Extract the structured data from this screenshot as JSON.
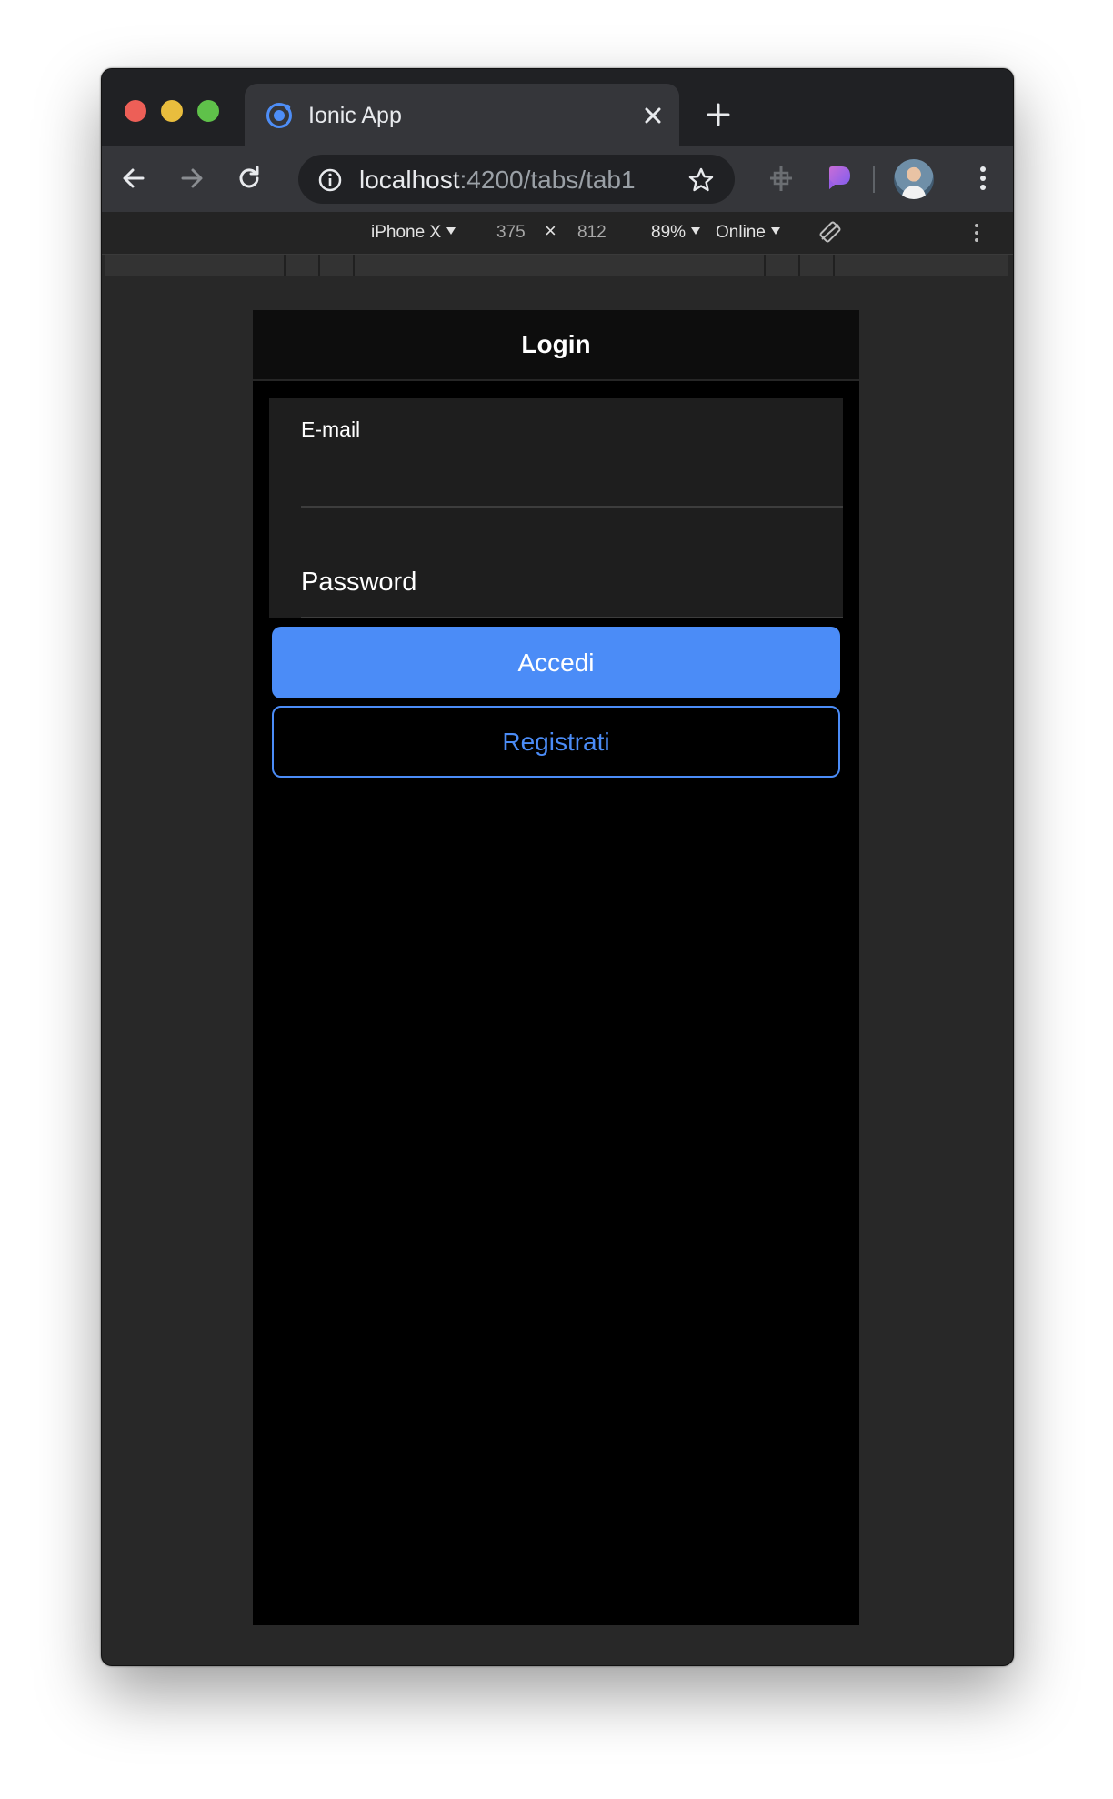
{
  "browser": {
    "tab": {
      "title": "Ionic App",
      "icon": "ionic-logo-icon",
      "close_icon": "close-icon"
    },
    "new_tab_icon": "plus-icon",
    "toolbar": {
      "back_icon": "back-arrow-icon",
      "forward_icon": "forward-arrow-icon",
      "reload_icon": "reload-icon",
      "url_host": "localhost",
      "url_path": ":4200/tabs/tab1",
      "info_icon": "info-icon",
      "bookmark_icon": "star-icon",
      "extension_icons": [
        "crosshair-extension-icon",
        "purple-extension-icon"
      ],
      "menu_icon": "kebab-menu-icon",
      "profile_icon": "profile-avatar"
    }
  },
  "devtools": {
    "device": "iPhone X",
    "width": "375",
    "times": "×",
    "height": "812",
    "zoom": "89%",
    "network": "Online",
    "rotate_icon": "rotate-icon",
    "more_icon": "kebab-menu-icon"
  },
  "app": {
    "header_title": "Login",
    "email_label": "E-mail",
    "email_value": "",
    "password_placeholder": "Password",
    "login_button": "Accedi",
    "register_button": "Registrati"
  },
  "colors": {
    "primary": "#4b8cf7",
    "app_background": "#000000",
    "window_chrome": "#35363a"
  }
}
